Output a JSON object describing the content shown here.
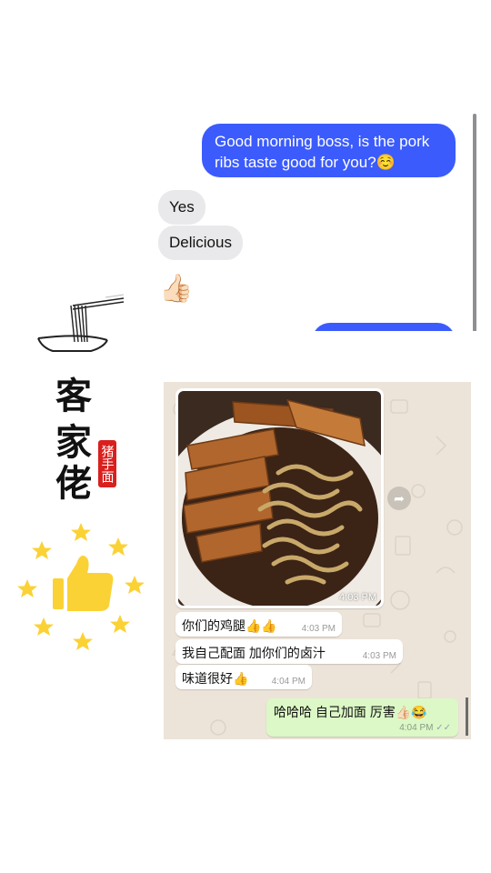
{
  "imessage": {
    "messages": [
      {
        "from": "me",
        "text": "Good morning boss, is the pork ribs taste good for you?☺️"
      },
      {
        "from": "them",
        "text": "Yes"
      },
      {
        "from": "them",
        "text": "Delicious"
      },
      {
        "from": "them",
        "text": "👍🏻"
      }
    ],
    "colors": {
      "outgoing": "#3b5bfd",
      "incoming": "#e9e9eb"
    }
  },
  "logo": {
    "chars": [
      "客",
      "家",
      "佬"
    ],
    "seal_text": "猪手面",
    "icon": "noodle-bowl-icon"
  },
  "decoration": {
    "icon": "thumbs-up-stars-icon",
    "colors": {
      "star": "#fbd235",
      "thumb": "#fbd235"
    }
  },
  "whatsapp": {
    "photo_time": "4:03 PM",
    "messages": [
      {
        "from": "them",
        "text": "你们的鸡腿👍👍",
        "time": "4:03 PM"
      },
      {
        "from": "them",
        "text": "我自己配面 加你们的卤汁",
        "time": "4:03 PM"
      },
      {
        "from": "them",
        "text": "味道很好👍",
        "time": "4:04 PM"
      },
      {
        "from": "me",
        "text": "哈哈哈 自己加面 厉害👍🏻😂",
        "time": "4:04 PM"
      }
    ],
    "colors": {
      "outgoing": "#dcf8c6",
      "incoming": "#ffffff",
      "background": "#ece4d9"
    }
  }
}
